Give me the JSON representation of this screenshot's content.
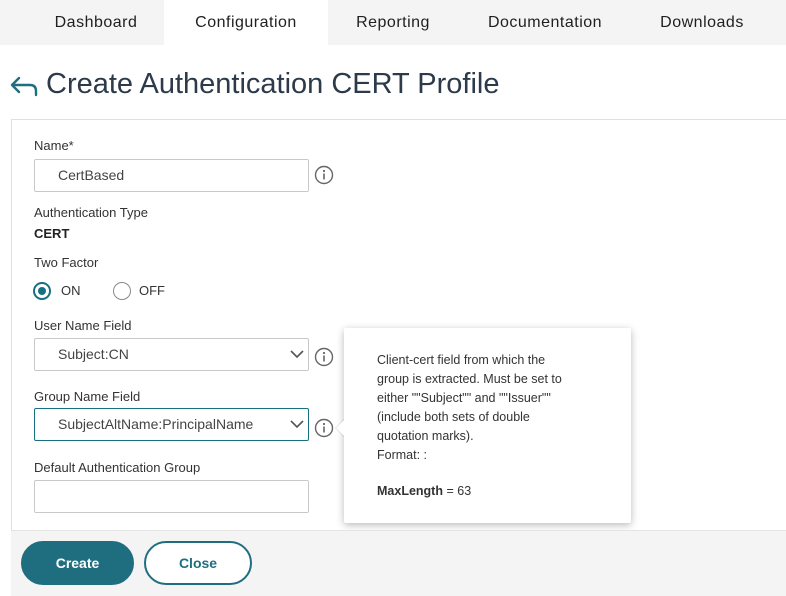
{
  "nav": {
    "tabs": [
      {
        "label": "Dashboard",
        "active": false
      },
      {
        "label": "Configuration",
        "active": true
      },
      {
        "label": "Reporting",
        "active": false
      },
      {
        "label": "Documentation",
        "active": false
      },
      {
        "label": "Downloads",
        "active": false
      }
    ]
  },
  "page": {
    "title": "Create Authentication CERT Profile",
    "back_icon": "back-arrow-icon"
  },
  "form": {
    "name": {
      "label": "Name*",
      "value": "CertBased"
    },
    "auth_type": {
      "label": "Authentication Type",
      "value": "CERT"
    },
    "two_factor": {
      "label": "Two Factor",
      "options": [
        {
          "label": "ON",
          "checked": true
        },
        {
          "label": "OFF",
          "checked": false
        }
      ]
    },
    "user_name_field": {
      "label": "User Name Field",
      "value": "Subject:CN"
    },
    "group_name_field": {
      "label": "Group Name Field",
      "value": "SubjectAltName:PrincipalName"
    },
    "default_auth_group": {
      "label": "Default Authentication Group",
      "value": ""
    }
  },
  "tooltip": {
    "text_lines": [
      "Client-cert field from which the",
      "group is extracted. Must be set to",
      "either \"\"Subject\"\" and \"\"Issuer\"\"",
      "(include both sets of double",
      "quotation marks).",
      "Format: :"
    ],
    "max_label": "MaxLength",
    "max_value": "= 63"
  },
  "footer": {
    "create_label": "Create",
    "close_label": "Close"
  },
  "colors": {
    "accent": "#1f6e80",
    "nav_bg": "#f4f4f4",
    "title": "#2c3a4a"
  }
}
